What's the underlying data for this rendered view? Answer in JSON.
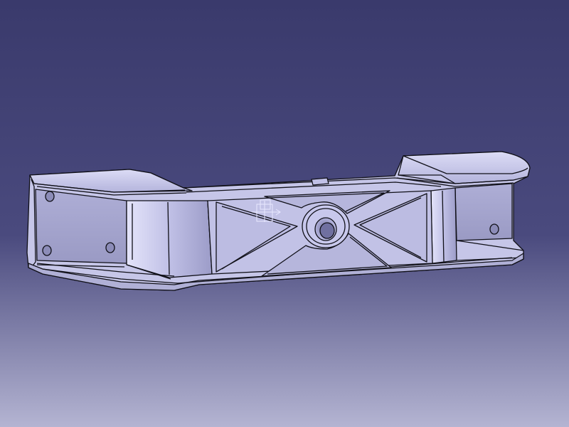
{
  "viewport": {
    "background_top": "#3a3a6c",
    "background_mid": "#4a4a7e",
    "background_bottom": "#b4b4d2"
  },
  "part": {
    "body_color": "#c8c8ea",
    "face_light": "#d2d2f2",
    "face_mid": "#a8a8d0",
    "face_dark": "#8c8cb6",
    "pocket_color": "#b8b8de",
    "edge_color": "#101018"
  },
  "compass": {
    "color": "#e8e8ff",
    "icon": "axis-triad-icon"
  }
}
